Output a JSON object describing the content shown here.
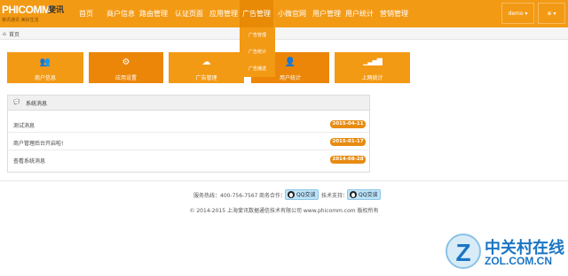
{
  "brand": {
    "logo_text": "PHICOMM",
    "logo_cn": "斐讯",
    "slogan": "斐讯通讯  美好生活"
  },
  "nav": {
    "items": [
      {
        "label": "首页"
      },
      {
        "label": "商户信息"
      },
      {
        "label": "路由管理"
      },
      {
        "label": "认证页面"
      },
      {
        "label": "应用管理"
      },
      {
        "label": "广告管理"
      },
      {
        "label": "小微官网"
      },
      {
        "label": "用户管理"
      },
      {
        "label": "用户统计"
      },
      {
        "label": "营销管理"
      }
    ],
    "user_label": "demo ▾",
    "extra_label": "⊕ ▾"
  },
  "submenu": {
    "items": [
      {
        "label": "广告管理"
      },
      {
        "label": "广告统计"
      },
      {
        "label": "广告播送"
      }
    ]
  },
  "breadcrumb": {
    "home_icon": "home-icon",
    "label": "首页"
  },
  "tiles": [
    {
      "label": "商户信息",
      "icon": "users-icon",
      "glyph": "👥"
    },
    {
      "label": "应用设置",
      "icon": "gears-icon",
      "glyph": "⚙"
    },
    {
      "label": "广告管理",
      "icon": "cloud-icon",
      "glyph": "☁"
    },
    {
      "label": "用户统计",
      "icon": "user-icon",
      "glyph": "👤"
    },
    {
      "label": "上网统计",
      "icon": "signal-icon",
      "glyph": "▁▃▅▇"
    }
  ],
  "panel": {
    "title": "系统消息",
    "messages": [
      {
        "text": "测试消息",
        "date": "2015-04-11"
      },
      {
        "text": "商户管理后台开启啦!",
        "date": "2015-01-17"
      },
      {
        "text": "查看系统消息",
        "date": "2014-08-28"
      }
    ]
  },
  "footer": {
    "hotline": "服务热线：400-756-7567",
    "business_label": "商务合作：",
    "tech_label": "技术支持：",
    "qq_label": "QQ交谈",
    "copyright": "© 2014-2015 上海斐讯数据通信技术有限公司 www.phicomm.com 版权所有"
  },
  "watermark": {
    "letter": "Z",
    "cn": "中关村在线",
    "en": "ZOL.COM.CN"
  },
  "colors": {
    "accent": "#f39a15",
    "accent_dark": "#ec8608",
    "badge": "#e78b12",
    "watermark": "#1a75c4"
  }
}
